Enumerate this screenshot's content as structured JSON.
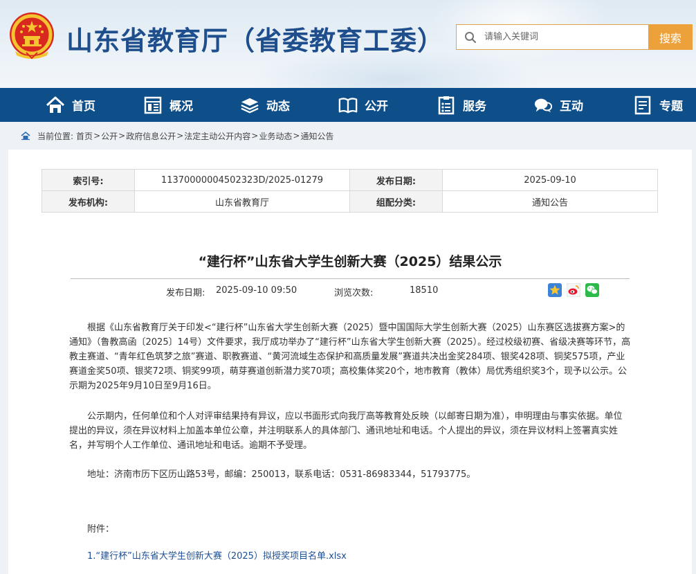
{
  "header": {
    "site_title": "山东省教育厅（省委教育工委）",
    "search_placeholder": "请输入关键词",
    "search_button": "搜索"
  },
  "nav": {
    "items": [
      {
        "label": "首页",
        "icon": "home-icon"
      },
      {
        "label": "概况",
        "icon": "overview-icon"
      },
      {
        "label": "动态",
        "icon": "news-stack-icon"
      },
      {
        "label": "公开",
        "icon": "open-book-icon"
      },
      {
        "label": "服务",
        "icon": "service-doc-icon"
      },
      {
        "label": "互动",
        "icon": "chat-bubble-icon"
      },
      {
        "label": "专题",
        "icon": "topic-doc-icon"
      }
    ]
  },
  "breadcrumb": {
    "prefix": "当前位置:",
    "items": [
      "首页",
      "公开",
      "政府信息公开",
      "法定主动公开内容",
      "业务动态",
      "通知公告"
    ],
    "separator": ">"
  },
  "meta": {
    "index_label": "索引号:",
    "index_value": "11370000004502323D/2025-01279",
    "date_label": "发布日期:",
    "date_value": "2025-09-10",
    "org_label": "发布机构:",
    "org_value": "山东省教育厅",
    "category_label": "组配分类:",
    "category_value": "通知公告"
  },
  "article": {
    "title": "“建行杯”山东省大学生创新大赛（2025）结果公示",
    "pub_label": "发布日期:",
    "pub_value": "2025-09-10 09:50",
    "views_label": "浏览次数:",
    "views_value": "18510",
    "paragraph1": "根据《山东省教育厅关于印发<“建行杯”山东省大学生创新大赛（2025）暨中国国际大学生创新大赛（2025）山东赛区选拔赛方案>的通知》（鲁教高函〔2025〕14号）文件要求，我厅成功举办了“建行杯”山东省大学生创新大赛（2025）。经过校级初赛、省级决赛等环节，高教主赛道、“青年红色筑梦之旅”赛道、职教赛道、“黄河流域生态保护和高质量发展”赛道共决出金奖284项、银奖428项、铜奖575项，产业赛道金奖50项、银奖72项、铜奖99项，萌芽赛道创新潜力奖70项；高校集体奖20个，地市教育（教体）局优秀组织奖3个，现予以公示。公示期为2025年9月10日至9月16日。",
    "paragraph2": "公示期内，任何单位和个人对评审结果持有异议，应以书面形式向我厅高等教育处反映（以邮寄日期为准），申明理由与事实依据。单位提出的异议，须在异议材料上加盖本单位公章，并注明联系人的具体部门、通讯地址和电话。个人提出的异议，须在异议材料上签署真实姓名，并写明个人工作单位、通讯地址和电话。逾期不予受理。",
    "address": "地址：济南市历下区历山路53号，邮编：250013，联系电话：0531-86983344，51793775。",
    "attachment_label": "附件：",
    "attachment_link": "1.“建行杯”山东省大学生创新大赛（2025）拟授奖项目名单.xlsx"
  },
  "colors": {
    "nav_bg": "#0f4f89",
    "title_blue": "#1f4e8c",
    "search_orange": "#eda13b",
    "link_blue": "#1d4e92"
  }
}
